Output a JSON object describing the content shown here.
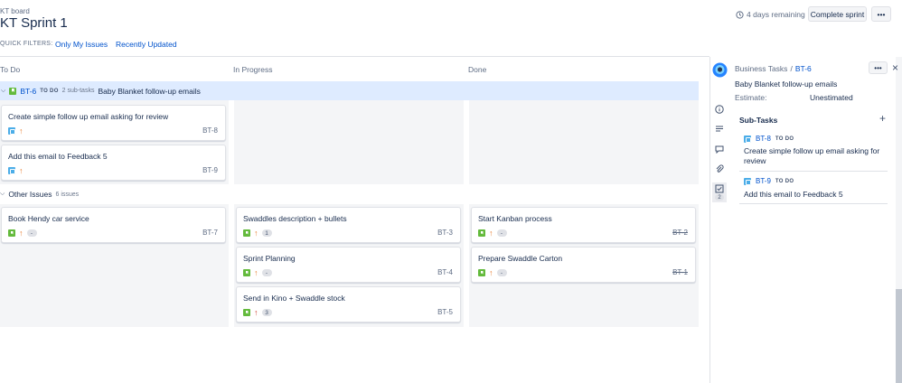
{
  "header": {
    "crumb": "KT board",
    "title": "KT Sprint 1",
    "remaining": "4 days remaining",
    "complete_label": "Complete sprint",
    "more_label": "•••"
  },
  "quick_filters": {
    "label": "QUICK FILTERS:",
    "items": [
      "Only My Issues",
      "Recently Updated"
    ]
  },
  "columns": [
    "To Do",
    "In Progress",
    "Done"
  ],
  "swimlane_parent": {
    "key": "BT-6",
    "status": "TO DO",
    "subtasks": "2 sub-tasks",
    "summary": "Baby Blanket follow-up emails"
  },
  "parent_cards": [
    {
      "title": "Create simple follow up email asking for review",
      "key": "BT-8"
    },
    {
      "title": "Add this email to Feedback 5",
      "key": "BT-9"
    }
  ],
  "other_issues": {
    "label": "Other Issues",
    "count": "6 issues"
  },
  "other_cards": {
    "todo": [
      {
        "title": "Book Hendy car service",
        "key": "BT-7",
        "points": "-"
      }
    ],
    "inprogress": [
      {
        "title": "Swaddles description + bullets",
        "key": "BT-3",
        "points": "1"
      },
      {
        "title": "Sprint Planning",
        "key": "BT-4",
        "points": "-"
      },
      {
        "title": "Send in Kino + Swaddle stock",
        "key": "BT-5",
        "points": "3"
      }
    ],
    "done": [
      {
        "title": "Start Kanban process",
        "key": "BT-2",
        "points": "-"
      },
      {
        "title": "Prepare Swaddle Carton",
        "key": "BT-1",
        "points": "-"
      }
    ]
  },
  "detail": {
    "project": "Business Tasks",
    "sep": "/",
    "key": "BT-6",
    "summary": "Baby Blanket follow-up emails",
    "estimate_label": "Estimate:",
    "estimate_value": "Unestimated",
    "subtasks_label": "Sub-Tasks",
    "add_label": "+",
    "close_label": "×",
    "attachment_count": "2",
    "subtasks": [
      {
        "key": "BT-8",
        "status": "TO DO",
        "title": "Create simple follow up email asking for review"
      },
      {
        "key": "BT-9",
        "status": "TO DO",
        "title": "Add this email to Feedback 5"
      }
    ]
  },
  "colors": {
    "accent": "#0052cc",
    "swimlane": "#deebff",
    "column_bg": "#f4f5f7",
    "story": "#63ba3c",
    "subtask": "#4bade8"
  }
}
